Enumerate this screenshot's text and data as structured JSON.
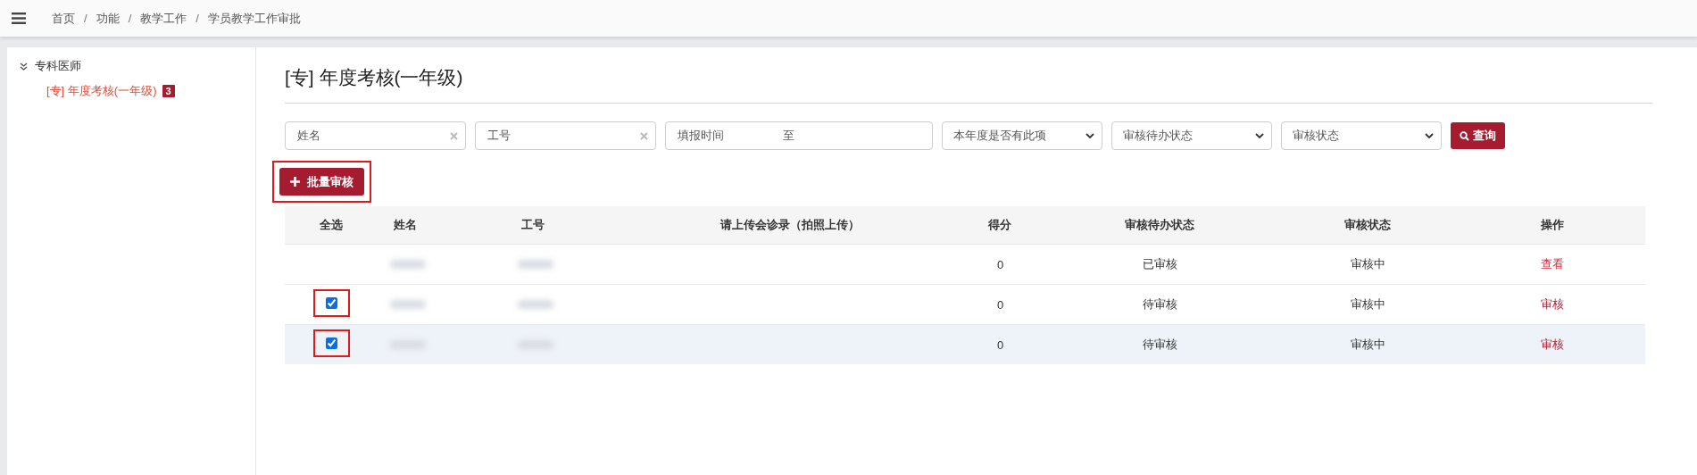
{
  "breadcrumb": {
    "items": [
      "首页",
      "功能",
      "教学工作",
      "学员教学工作审批"
    ],
    "separator": "/"
  },
  "sidebar": {
    "group": {
      "label": "专科医师",
      "expanded": true,
      "children": [
        {
          "label": "[专] 年度考核(一年级)",
          "badge": "3",
          "selected": true
        }
      ]
    }
  },
  "page_title": "[专] 年度考核(一年级)",
  "filters": [
    {
      "kind": "text",
      "placeholder": "姓名"
    },
    {
      "kind": "text",
      "placeholder": "工号"
    },
    {
      "kind": "range",
      "placeholder": "填报时间",
      "separator": "至"
    },
    {
      "kind": "select",
      "value": "本年度是否有此项"
    },
    {
      "kind": "select",
      "value": "审核待办状态"
    },
    {
      "kind": "select",
      "value": "审核状态"
    }
  ],
  "query_button": "查询",
  "batch_button": {
    "label": "批量审核",
    "highlighted": true
  },
  "table": {
    "columns": [
      "全选",
      "姓名",
      "工号",
      "请上传会诊录（拍照上传）",
      "得分",
      "审核待办状态",
      "审核状态",
      "操作"
    ],
    "rows": [
      {
        "kind": "plain",
        "hovered": false,
        "score": "0",
        "todo_status": "已审核",
        "status": "审核中",
        "action": "查看",
        "action_visited": false
      },
      {
        "kind": "checkable",
        "checked": true,
        "hovered": false,
        "score": "0",
        "todo_status": "待审核",
        "status": "审核中",
        "action": "审核",
        "action_visited": true
      },
      {
        "kind": "checkable",
        "checked": true,
        "hovered": true,
        "score": "0",
        "todo_status": "待审核",
        "status": "审核中",
        "action": "审核",
        "action_visited": true
      }
    ],
    "checkbox_highlighted": true
  }
}
